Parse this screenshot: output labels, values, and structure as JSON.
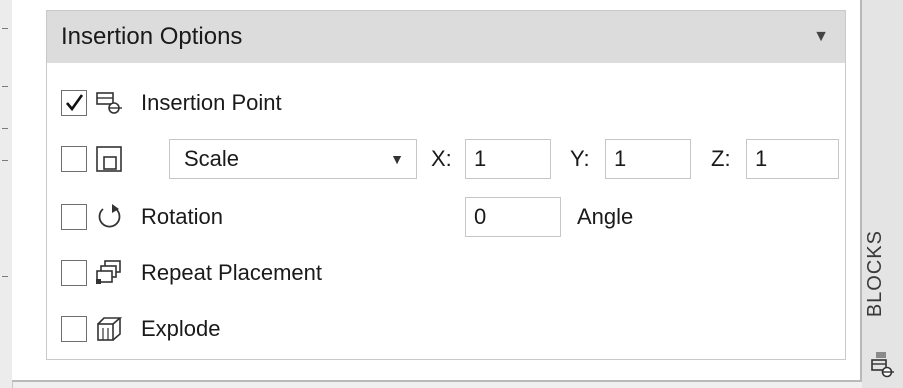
{
  "section": {
    "title": "Insertion Options"
  },
  "rows": {
    "insertion_point": {
      "label": "Insertion Point",
      "checked": true,
      "icon": "insertion-point-icon"
    },
    "scale": {
      "checked": false,
      "icon": "scale-icon",
      "mode": "Scale",
      "x_label": "X:",
      "x_value": "1",
      "y_label": "Y:",
      "y_value": "1",
      "z_label": "Z:",
      "z_value": "1"
    },
    "rotation": {
      "label": "Rotation",
      "checked": false,
      "icon": "rotation-icon",
      "angle_value": "0",
      "angle_label": "Angle"
    },
    "repeat_placement": {
      "label": "Repeat Placement",
      "checked": false,
      "icon": "repeat-placement-icon"
    },
    "explode": {
      "label": "Explode",
      "checked": false,
      "icon": "explode-icon"
    }
  },
  "side_palette": {
    "label": "BLOCKS",
    "icon": "blocks-palette-icon"
  }
}
